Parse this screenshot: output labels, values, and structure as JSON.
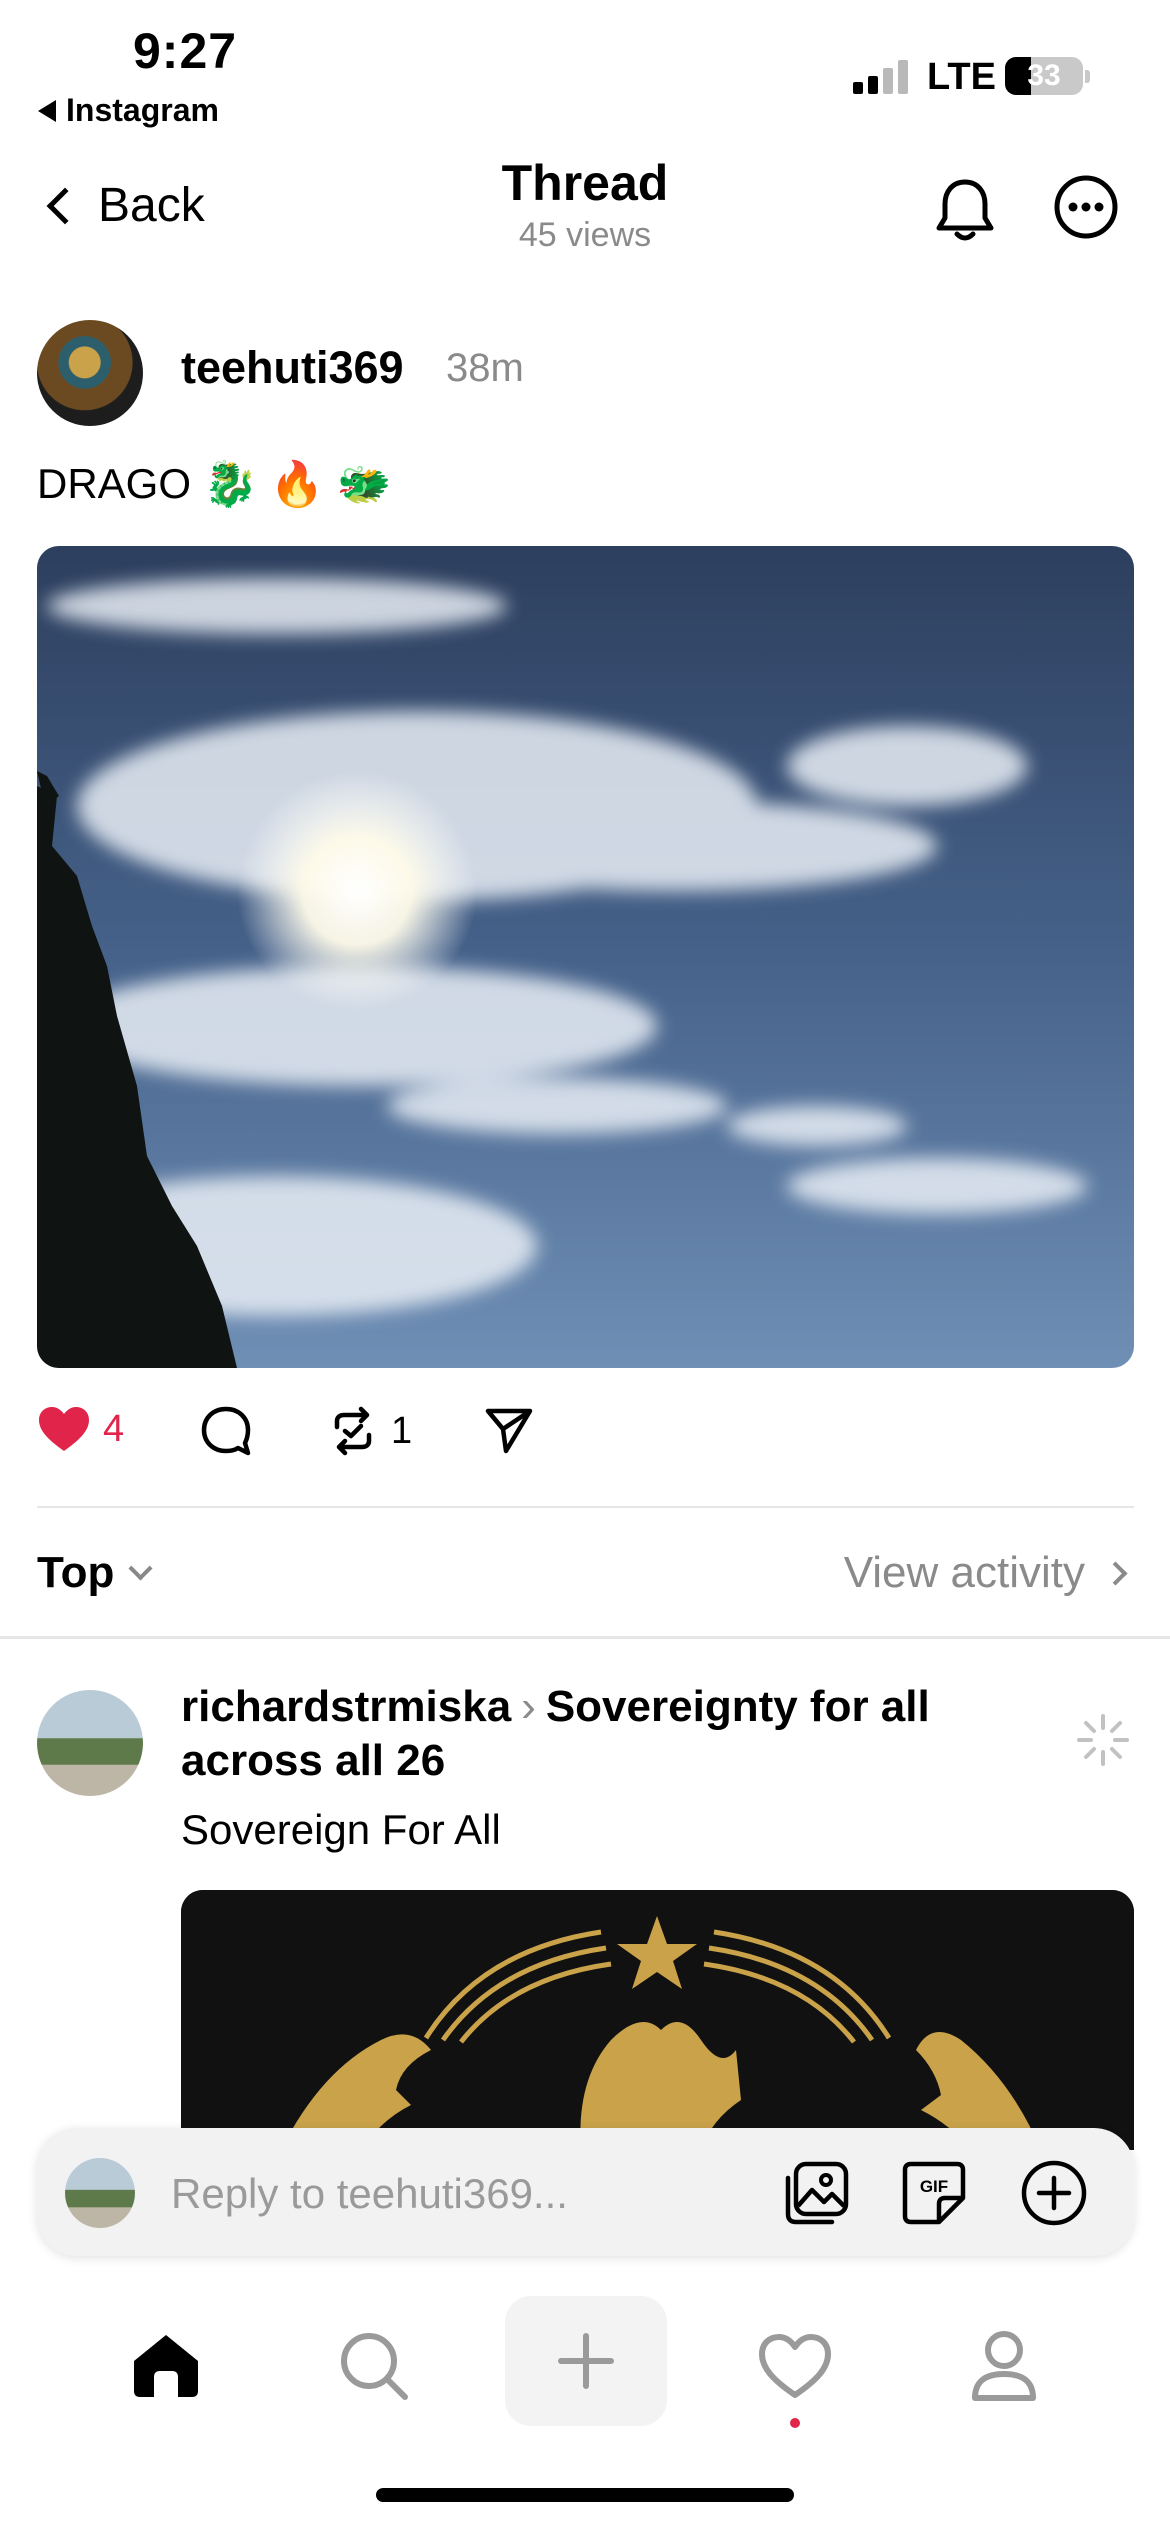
{
  "status_bar": {
    "time": "9:27",
    "back_app": "Instagram",
    "network": "LTE",
    "battery": "33"
  },
  "header": {
    "back_label": "Back",
    "title": "Thread",
    "views": "45 views"
  },
  "post": {
    "username": "teehuti369",
    "age": "38m",
    "text": "DRAGO",
    "emojis": [
      "🐉",
      "🔥",
      "🐲"
    ],
    "likes": "4",
    "reposts": "1"
  },
  "sort": {
    "label": "Top",
    "view_activity": "View activity"
  },
  "reply": {
    "username": "richardstrmiska",
    "thread_title": "Sovereignty for all across all 26",
    "text": "Sovereign For All"
  },
  "reply_bar": {
    "placeholder": "Reply to teehuti369..."
  },
  "colors": {
    "accent": "#e0244a",
    "muted": "#8a8a8a"
  }
}
